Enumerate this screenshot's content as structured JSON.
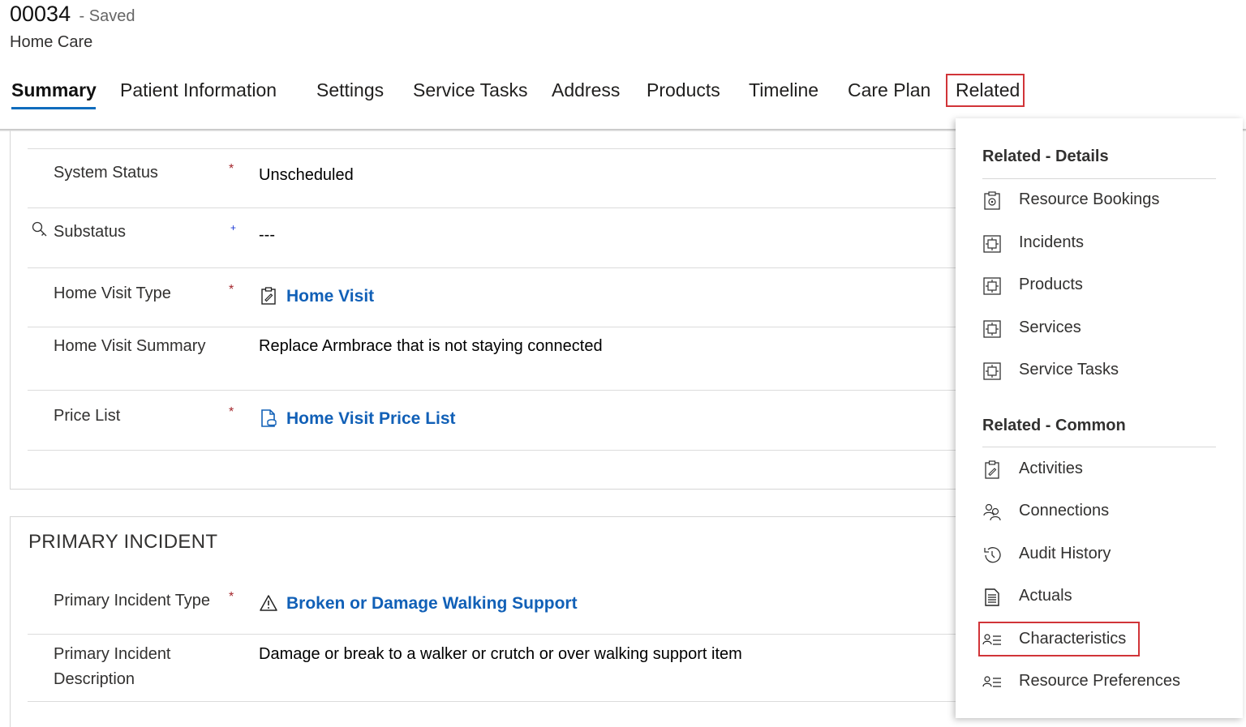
{
  "record": {
    "id": "00034",
    "status": "- Saved",
    "type": "Home Care"
  },
  "tabs": [
    {
      "label": "Summary"
    },
    {
      "label": "Patient Information"
    },
    {
      "label": "Settings"
    },
    {
      "label": "Service Tasks"
    },
    {
      "label": "Address"
    },
    {
      "label": "Products"
    },
    {
      "label": "Timeline"
    },
    {
      "label": "Care Plan"
    },
    {
      "label": "Related"
    }
  ],
  "form": {
    "system_status": {
      "label": "System Status",
      "value": "Unscheduled"
    },
    "substatus": {
      "label": "Substatus",
      "value": "---"
    },
    "home_visit_type": {
      "label": "Home Visit Type",
      "value": "Home Visit"
    },
    "home_visit_summary": {
      "label": "Home Visit Summary",
      "value": "Replace Armbrace that is not staying connected"
    },
    "price_list": {
      "label": "Price List",
      "value": "Home Visit Price List"
    },
    "primary_incident_section": "PRIMARY INCIDENT",
    "primary_incident_type": {
      "label": "Primary Incident Type",
      "value": "Broken or Damage Walking Support"
    },
    "primary_incident_description": {
      "label_line1": "Primary Incident",
      "label_line2": "Description",
      "value": "Damage or break to a walker or crutch or over walking support item"
    }
  },
  "required_marker": "*",
  "recommended_marker": "+",
  "related_menu": {
    "details_title": "Related - Details",
    "details_items": [
      {
        "label": "Resource Bookings",
        "icon": "resource-booking-icon"
      },
      {
        "label": "Incidents",
        "icon": "entity-icon"
      },
      {
        "label": "Products",
        "icon": "entity-icon"
      },
      {
        "label": "Services",
        "icon": "entity-icon"
      },
      {
        "label": "Service Tasks",
        "icon": "entity-icon"
      }
    ],
    "common_title": "Related - Common",
    "common_items": [
      {
        "label": "Activities",
        "icon": "clipboard-icon"
      },
      {
        "label": "Connections",
        "icon": "people-icon"
      },
      {
        "label": "Audit History",
        "icon": "history-icon"
      },
      {
        "label": "Actuals",
        "icon": "document-icon"
      },
      {
        "label": "Characteristics",
        "icon": "person-list-icon"
      },
      {
        "label": "Resource Preferences",
        "icon": "person-list-icon"
      }
    ]
  },
  "colors": {
    "accent": "#0f6cbd",
    "link": "#1160b7",
    "highlight": "#d13438",
    "required": "#a4262c"
  }
}
